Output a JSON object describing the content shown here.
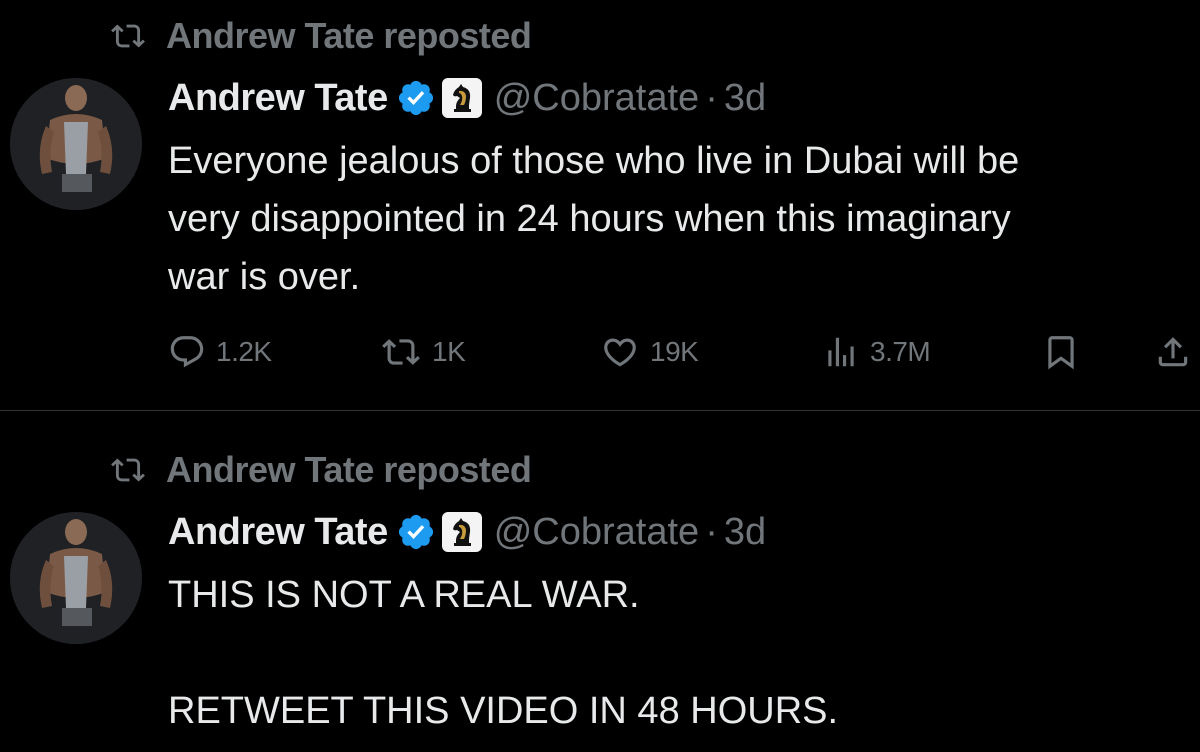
{
  "tweets": [
    {
      "repost_label": "Andrew Tate reposted",
      "author": {
        "name": "Andrew Tate",
        "handle": "@Cobratate",
        "time": "3d"
      },
      "text": "Everyone jealous of those who live in Dubai will be\nvery disappointed in 24 hours when this imaginary\nwar is over.",
      "metrics": {
        "replies": "1.2K",
        "retweets": "1K",
        "likes": "19K",
        "views": "3.7M"
      }
    },
    {
      "repost_label": "Andrew Tate reposted",
      "author": {
        "name": "Andrew Tate",
        "handle": "@Cobratate",
        "time": "3d"
      },
      "text": "THIS IS NOT A REAL WAR.\n\nRETWEET THIS VIDEO IN 48 HOURS."
    }
  ],
  "icons": {
    "repost": "repost-icon",
    "verified": "verified-badge-icon",
    "affiliate": "chess-knight-icon",
    "reply": "reply-icon",
    "retweet": "retweet-icon",
    "like": "heart-icon",
    "views": "views-chart-icon",
    "bookmark": "bookmark-icon",
    "share": "share-icon"
  },
  "colors": {
    "background": "#000000",
    "text_primary": "#e7e9ea",
    "text_secondary": "#71767b",
    "verified_blue": "#1d9bf0",
    "divider": "#2f3336"
  },
  "separator": "·"
}
